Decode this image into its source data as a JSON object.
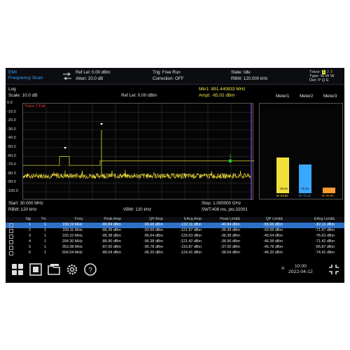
{
  "header": {
    "mode_line1": "EMI",
    "mode_line2": "Frequency Scan",
    "ref_level": "Ref Lel: 0.00 dBm",
    "atten": "Atten: 20.0 dB",
    "trigger": "Trig: Free Run",
    "correction": "Correction: OFF",
    "state": "State: Idle",
    "rbw": "RBW: 120.000 kHz",
    "trace_label": "Trace:",
    "trace_nums": [
      "1",
      "2",
      "3"
    ],
    "type_label": "Type:",
    "type_value": "W W W",
    "det_label": "Det:",
    "det_value": "P Q E"
  },
  "subheader": {
    "log": "Log",
    "scale": "Scale: 10.0 dB",
    "ref_lel": "Ref Lel: 0.00 dBm",
    "marker_freq": "Mkr1:  891.440833 MHz",
    "marker_ampt": "Ampt:           -65.02 dBm"
  },
  "graph": {
    "trace_fail": "Trace 1 Fail",
    "y_labels": [
      "0.0",
      "-10.0",
      "-20.0",
      "-30.0",
      "-40.0",
      "-50.0",
      "-60.0",
      "-70.0",
      "-80.0",
      "-90.0",
      "-100.0"
    ],
    "marker_number": "1",
    "colors": {
      "trace": "#f0e13a",
      "marker": "#2bd62b",
      "limit": "#f0e13a",
      "stop_line": "#8b3fd0"
    }
  },
  "meters": {
    "labels": [
      "Meter1",
      "Meter2",
      "Meter3"
    ],
    "label_colors": [
      "#f0e13a",
      "#3aa7ff",
      "#ff9a2e"
    ],
    "values_top": [
      "-66.53",
      "-75.15",
      "-103.14"
    ],
    "values_bottom": [
      "M:-63.82",
      "M:-75.13",
      "M:-94.68"
    ],
    "levels_dbm": [
      -66.53,
      -75.15,
      -103.14
    ]
  },
  "footer": {
    "start": "Start: 30.000 MHz",
    "stop": "Stop: 1.000000 GHz",
    "rbw": "RBW: 120 kHz",
    "vbw": "VBW: 120 kHz",
    "swt": "SWT:408 ms, pts:32001"
  },
  "table": {
    "columns": [
      "Sig",
      "Trc",
      "Freq",
      "Peak Amp",
      "QP Amp",
      "EAvg Amp",
      "Peak LimitΔ",
      "QP LimitΔ",
      "EAvg LimitΔ"
    ],
    "rows": [
      [
        "1",
        "1",
        "158.19 MHz",
        "-80.84 dBm",
        "-95.66 dBm",
        "-122.11 dBm",
        "-40.84 dBm",
        "-55.66 dBm",
        "-82.11 dBm"
      ],
      [
        "2",
        "1",
        "209.11 MHz",
        "-86.39 dBm",
        "-93.59 dBm",
        "-121.97 dBm",
        "-36.39 dBm",
        "-43.59 dBm",
        "-71.97 dBm"
      ],
      [
        "3",
        "1",
        "220.10 MHz",
        "-86.38 dBm",
        "-95.64 dBm",
        "-126.63 dBm",
        "-36.38 dBm",
        "-45.64 dBm",
        "-76.63 dBm"
      ],
      [
        "4",
        "1",
        "294.30 MHz",
        "-86.90 dBm",
        "-96.38 dBm",
        "-121.42 dBm",
        "-36.90 dBm",
        "-46.38 dBm",
        "-71.42 dBm"
      ],
      [
        "5",
        "1",
        "353.38 MHz",
        "-87.00 dBm",
        "-95.78 dBm",
        "-115.87 dBm",
        "-37.00 dBm",
        "-45.78 dBm",
        "-65.87 dBm"
      ],
      [
        "6",
        "1",
        "504.04 MHz",
        "-88.04 dBm",
        "-96.20 dBm",
        "-124.41 dBm",
        "-38.04 dBm",
        "-46.20 dBm",
        "-74.41 dBm"
      ]
    ]
  },
  "statusbar": {
    "time": "10:00",
    "date": "2022-04-12",
    "network_icon": "A"
  }
}
